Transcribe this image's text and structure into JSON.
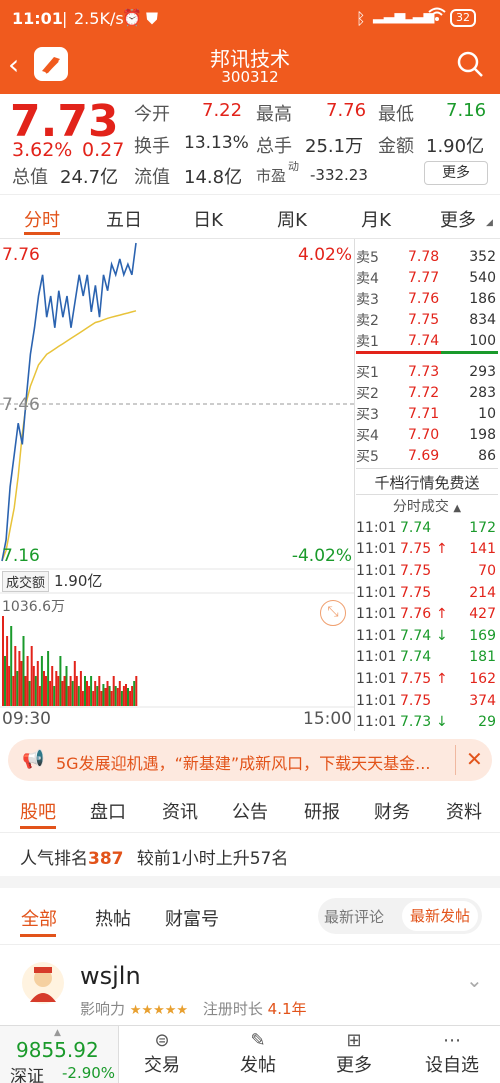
{
  "status_bar": {
    "time": "11:01",
    "net": "2.5K/s",
    "battery": "32"
  },
  "header": {
    "title": "邦讯技术",
    "code": "300312"
  },
  "quote": {
    "price": "7.73",
    "change_pct": "3.62%",
    "change": "0.27",
    "open_label": "今开",
    "open": "7.22",
    "high_label": "最高",
    "high": "7.76",
    "low_label": "最低",
    "low": "7.16",
    "turnover_label": "换手",
    "turnover": "13.13%",
    "volume_label": "总手",
    "volume": "25.1万",
    "amount_label": "金额",
    "amount": "1.90亿",
    "mktcap_label": "总值",
    "mktcap": "24.7亿",
    "float_label": "流值",
    "float": "14.8亿",
    "pe_label": "市盈",
    "pe_sup": "动",
    "pe": "-332.23",
    "more_label": "更多"
  },
  "chart_tabs": [
    "分时",
    "五日",
    "日K",
    "周K",
    "月K",
    "更多"
  ],
  "intraday": {
    "top_price": "7.76",
    "top_pct": "4.02%",
    "mid_price": "7.46",
    "bottom_price": "7.16",
    "bottom_pct": "-4.02%",
    "vol_label": "成交额",
    "vol_value": "1.90亿",
    "vol_max": "1036.6万",
    "start_time": "09:30",
    "end_time": "15:00"
  },
  "order_book": {
    "asks": [
      {
        "label": "卖5",
        "price": "7.78",
        "vol": "352"
      },
      {
        "label": "卖4",
        "price": "7.77",
        "vol": "540"
      },
      {
        "label": "卖3",
        "price": "7.76",
        "vol": "186"
      },
      {
        "label": "卖2",
        "price": "7.75",
        "vol": "834"
      },
      {
        "label": "卖1",
        "price": "7.74",
        "vol": "100"
      }
    ],
    "bids": [
      {
        "label": "买1",
        "price": "7.73",
        "vol": "293"
      },
      {
        "label": "买2",
        "price": "7.72",
        "vol": "283"
      },
      {
        "label": "买3",
        "price": "7.71",
        "vol": "10"
      },
      {
        "label": "买4",
        "price": "7.70",
        "vol": "198"
      },
      {
        "label": "买5",
        "price": "7.69",
        "vol": "86"
      }
    ],
    "promo": "千档行情免费送",
    "ticks_label": "分时成交"
  },
  "ticks": [
    {
      "time": "11:01",
      "price": "7.74",
      "arrow": "",
      "vol": "172",
      "color": "green"
    },
    {
      "time": "11:01",
      "price": "7.75",
      "arrow": "↑",
      "vol": "141",
      "color": "red"
    },
    {
      "time": "11:01",
      "price": "7.75",
      "arrow": "",
      "vol": "70",
      "color": "red"
    },
    {
      "time": "11:01",
      "price": "7.75",
      "arrow": "",
      "vol": "214",
      "color": "red"
    },
    {
      "time": "11:01",
      "price": "7.76",
      "arrow": "↑",
      "vol": "427",
      "color": "red"
    },
    {
      "time": "11:01",
      "price": "7.74",
      "arrow": "↓",
      "vol": "169",
      "color": "green"
    },
    {
      "time": "11:01",
      "price": "7.74",
      "arrow": "",
      "vol": "181",
      "color": "green"
    },
    {
      "time": "11:01",
      "price": "7.75",
      "arrow": "↑",
      "vol": "162",
      "color": "red"
    },
    {
      "time": "11:01",
      "price": "7.75",
      "arrow": "",
      "vol": "374",
      "color": "red"
    },
    {
      "time": "11:01",
      "price": "7.73",
      "arrow": "↓",
      "vol": "29",
      "color": "green"
    }
  ],
  "banner": {
    "text": "5G发展迎机遇，“新基建”成新风口，下载天天基金..."
  },
  "section_tabs": [
    "股吧",
    "盘口",
    "资讯",
    "公告",
    "研报",
    "财务",
    "资料"
  ],
  "ranking": {
    "prefix": "人气排名",
    "rank": "387",
    "suffix": "较前1小时上升57名"
  },
  "feed_tabs": [
    "全部",
    "热帖",
    "财富号"
  ],
  "sort_options": [
    "最新评论",
    "最新发帖"
  ],
  "post": {
    "user": "wsjln",
    "influence_label": "影响力",
    "stars": "★★★★★",
    "reg_label": "注册时长",
    "reg_value": "4.1年"
  },
  "bottom_bar": {
    "index_value": "9855.92",
    "index_name": "深证",
    "index_change": "-2.90%",
    "items": [
      "交易",
      "发帖",
      "更多",
      "设自选"
    ]
  },
  "colors": {
    "brand": "#f05a1e",
    "up": "#e2231a",
    "down": "#1a9a2b",
    "price_line": "#2b63b0",
    "avg_line": "#e8c33a"
  }
}
